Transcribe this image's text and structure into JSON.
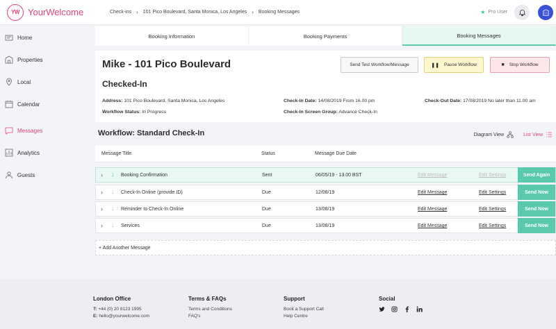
{
  "header": {
    "logo_mark": "YW",
    "logo_text": "YourWelcome",
    "breadcrumb": [
      "Check-ins",
      "101 Pico Boulevard, Santa Monica, Los Angeles",
      "Booking Messages"
    ],
    "user_label": "Pro User"
  },
  "sidebar": {
    "items": [
      {
        "label": "Home",
        "icon": "home-icon"
      },
      {
        "label": "Properties",
        "icon": "properties-icon"
      },
      {
        "label": "Local",
        "icon": "local-pin-icon"
      },
      {
        "label": "Calendar",
        "icon": "calendar-icon"
      },
      {
        "label": "Messages",
        "icon": "messages-icon"
      },
      {
        "label": "Analytics",
        "icon": "analytics-icon"
      },
      {
        "label": "Guests",
        "icon": "guests-icon"
      }
    ],
    "active": "Messages"
  },
  "tabs": [
    "Booking Information",
    "Booking Payments",
    "Booking Messages"
  ],
  "booking": {
    "title": "Mike - 101 Pico Boulevard",
    "status": "Checked-In",
    "buttons": {
      "test": "Send Test Workflow/Message",
      "pause": "Pause Workflow",
      "stop": "Stop Workflow"
    },
    "address_label": "Address:",
    "address": "101 Pico Boulevard, Santa Monica, Los Angeles",
    "workflow_status_label": "Workflow Status:",
    "workflow_status": "In Progress",
    "checkin_label": "Check-In Date:",
    "checkin": "14/08/2019 From 16.00 pm",
    "screen_group_label": "Check-In Screen Group:",
    "screen_group": "Advance Check-In",
    "checkout_label": "Check-Out Date:",
    "checkout": "17/08/2019 No later than 11.00 am"
  },
  "workflow": {
    "heading": "Workflow: Standard Check-In",
    "diagram_view": "Diagram View",
    "list_view": "List View",
    "columns": [
      "Message Title",
      "Status",
      "Message Due Date"
    ],
    "rows": [
      {
        "title": "Booking Confirmation",
        "status": "Sent",
        "due": "06/05/19 - 13.00 BST",
        "edit_message": "Edit Message",
        "edit_settings": "Edit Settings",
        "action": "Send Again"
      },
      {
        "title": "Check-In Online (provide ID)",
        "status": "Due",
        "due": "12/08/19",
        "edit_message": "Edit Message",
        "edit_settings": "Edit Settings",
        "action": "Send Now"
      },
      {
        "title": "Reminder to Check-In Online",
        "status": "Due",
        "due": "13/08/19",
        "edit_message": "Edit Message",
        "edit_settings": "Edit Settings",
        "action": "Send Now"
      },
      {
        "title": "Services",
        "status": "Due",
        "due": "13/08/19",
        "edit_message": "Edit Message",
        "edit_settings": "Edit Settings",
        "action": "Send Now"
      }
    ],
    "add_message": "+ Add Another Message"
  },
  "footer": {
    "office_heading": "London Office",
    "phone_label": "T:",
    "phone": "+44 (0) 20 8123 1995",
    "email_label": "E:",
    "email": "hello@yourwelcome.com",
    "terms_heading": "Terms & FAQs",
    "terms_link": "Terms and Conditions",
    "faq_link": "FAQ's",
    "support_heading": "Support",
    "support_call": "Book a Support Call",
    "help_centre": "Help Centre",
    "social_heading": "Social",
    "social_icons": [
      "twitter-icon",
      "instagram-icon",
      "facebook-icon",
      "linkedin-icon"
    ]
  },
  "colors": {
    "brand_pink": "#e2457a",
    "teal": "#5ac9ad",
    "pause_yellow": "#fdf6cf",
    "stop_pink": "#fde7ea",
    "avatar_blue": "#3a4fd8"
  }
}
